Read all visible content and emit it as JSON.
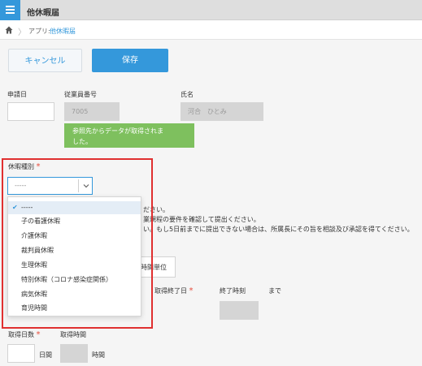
{
  "header": {
    "title": "他休暇届"
  },
  "breadcrumb": {
    "app_label": "アプリ:",
    "app_link": "他休暇届"
  },
  "toolbar": {
    "cancel_label": "キャンセル",
    "save_label": "保存"
  },
  "form": {
    "application_date": {
      "label": "申請日",
      "value": ""
    },
    "employee_number": {
      "label": "従業員番号",
      "value": "7005"
    },
    "name": {
      "label": "氏名",
      "value": "河合　ひとみ"
    },
    "lookup_notice": {
      "line1": "参照先からデータが取得されま",
      "line2": "した。"
    },
    "leave_type": {
      "label": "休暇種別",
      "required_mark": "*",
      "selected": "-----",
      "options": [
        "-----",
        "子の看護休暇",
        "介護休暇",
        "裁判員休暇",
        "生理休暇",
        "特別休暇（コロナ感染症関係）",
        "病気休暇",
        "育児時間"
      ]
    },
    "background_text": {
      "line1": "ださい。",
      "line2": "業規程の要件を確認して提出ください。",
      "line3": "い。もし5日前までに提出できない場合は、所属長にその旨を相談及び承認を得てください。",
      "unit": "時間単位"
    },
    "end_date": {
      "label": "取得終了日",
      "required_mark": "*"
    },
    "end_time": {
      "label": "終了時刻",
      "suffix": "まで"
    },
    "days_taken": {
      "label": "取得日数",
      "required_mark": "*",
      "unit": "日間"
    },
    "hours_taken": {
      "label": "取得時間",
      "unit": "時間"
    }
  },
  "colors": {
    "accent": "#3498db",
    "highlight_frame": "#e03030",
    "notice_bg": "#7ec05e"
  }
}
